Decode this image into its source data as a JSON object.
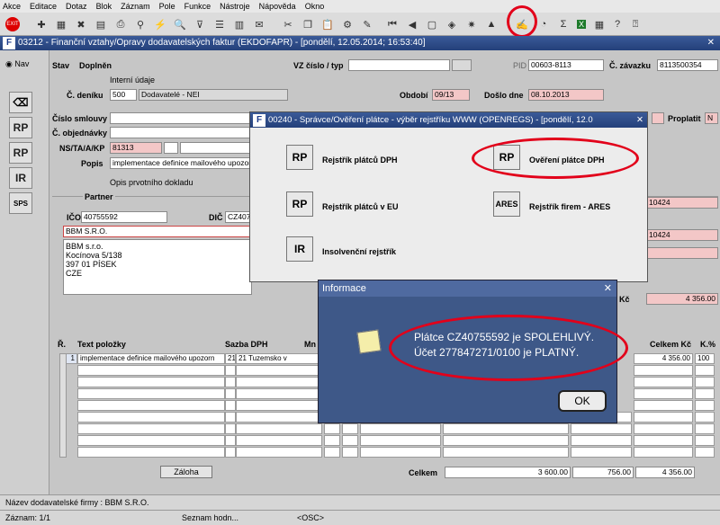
{
  "menu": [
    "Akce",
    "Editace",
    "Dotaz",
    "Blok",
    "Záznam",
    "Pole",
    "Funkce",
    "Nástroje",
    "Nápověda",
    "Okno"
  ],
  "window": {
    "title": "03212 - Finanční vztahy/Opravy dodavatelských faktur (EKDOFAPR) - [pondělí, 12.05.2014; 16:53:40]"
  },
  "nav": {
    "label": "Nav"
  },
  "header": {
    "stav_label": "Stav",
    "stav_value": "Doplněn",
    "vz_label": "VZ číslo / typ",
    "pid_label": "PID",
    "pid_value": "00603-8113",
    "zavazek_label": "Č. závazku",
    "zavazek_value": "8113500354",
    "interni_label": "Interní údaje",
    "denik_label": "Č. deníku",
    "denik_value": "500",
    "denik_name": "Dodavatelé - NEI",
    "obdobi_label": "Období",
    "obdobi_value": "09/13",
    "doslo_label": "Došlo dne",
    "doslo_value": "08.10.2013",
    "smlouva_label": "Číslo smlouvy",
    "objednavka_label": "Č. objednávky",
    "ns_label": "NS/TA/A/KP",
    "ns_value": "81313",
    "popis_label": "Popis",
    "popis_value": "implementace definice mailového upozor",
    "proplatit_label": "Proplatit",
    "proplatit_value": "N",
    "opis_label": "Opis prvotního dokladu",
    "partner_label": "Partner",
    "ico_label": "IČO",
    "ico_value": "40755592",
    "dic_label": "DIČ",
    "dic_value": "CZ407",
    "partner_name": "BBM S.R.O.",
    "address": [
      "BBM s.r.o.",
      "Kocínova 5/138",
      "397 01 PÍSEK",
      "CZE"
    ],
    "right_val1": "10424",
    "right_val2": "10424",
    "kc_label": "Kč",
    "kc_value": "4 356.00"
  },
  "dialog_registry": {
    "title": "00240 - Správce/Ověření plátce - výběr rejstříku WWW (OPENREGS) - [pondělí, 12.0",
    "items": [
      {
        "icon": "RP",
        "label": "Rejstřík plátců DPH"
      },
      {
        "icon": "RP",
        "label": "Ověření plátce DPH"
      },
      {
        "icon": "RP",
        "label": "Rejstřík plátců v EU"
      },
      {
        "icon": "ARES",
        "label": "Rejstřík firem - ARES"
      },
      {
        "icon": "IR",
        "label": "Insolvenční rejstřík"
      }
    ]
  },
  "dialog_info": {
    "title": "Informace",
    "line1": "Plátce CZ40755592 je SPOLEHLIVÝ.",
    "line2": "Účet 277847271/0100 je PLATNÝ.",
    "ok": "OK"
  },
  "grid": {
    "headers": {
      "r": "Ř.",
      "text": "Text položky",
      "sazba": "Sazba DPH",
      "mn": "Mn",
      "celkem": "Celkem Kč",
      "k": "K.%"
    },
    "row1": {
      "r": "1",
      "text": "implementace definice mailového upozorn",
      "sazba1": "21",
      "sazba2": "21  Tuzemsko v",
      "celkem": "4 356.00",
      "k": "100"
    },
    "zaloha": "Záloha",
    "celkem_label": "Celkem",
    "celkem1": "3 600.00",
    "celkem2": "756.00",
    "celkem3": "4 356.00"
  },
  "status": {
    "line1": "Název dodavatelské firmy : BBM S.R.O.",
    "zaznam": "Záznam: 1/1",
    "seznam": "Seznam hodn...",
    "osc": "<OSC>"
  }
}
